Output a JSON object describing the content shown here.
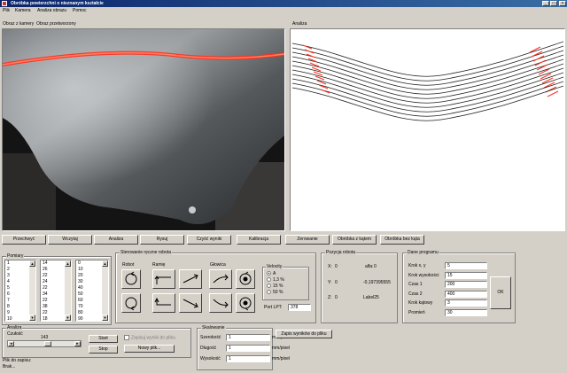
{
  "window": {
    "title": "Obróbka powierzchni o nieznanym kształcie"
  },
  "menu": [
    "Plik",
    "Kamera",
    "Analiza obrazu",
    "Pomoc"
  ],
  "camera": {
    "label_camera": "Obraz z kamery",
    "label_processed": "Obraz przetworzony"
  },
  "analysis": {
    "label": "Analiza"
  },
  "toolbar": [
    "Przechwyć",
    "Wczytaj",
    "Analiza",
    "Rysuj",
    "Czyść wyniki",
    "Kalibracja",
    "Zerowanie",
    "Obróbka z kątem",
    "Obróbka bez kąta"
  ],
  "lists": {
    "title": "Pomiary",
    "col1": [
      "1",
      "2",
      "3",
      "4",
      "5",
      "6",
      "7",
      "8",
      "9",
      "10"
    ],
    "col2": [
      "14",
      "26",
      "22",
      "24",
      "22",
      "34",
      "22",
      "38",
      "22",
      "18"
    ],
    "col3": [
      "0",
      "10",
      "20",
      "30",
      "40",
      "50",
      "60",
      "70",
      "80",
      "90",
      "100"
    ]
  },
  "manual": {
    "title": "Sterowanie ręczne robota",
    "robot": "Robot",
    "arm": "Ramię",
    "head": "Głowica",
    "velocity": {
      "title": "Velocity",
      "options": [
        "A",
        "1,3 %",
        "15 %",
        "50 %"
      ],
      "selected": 0
    },
    "port_label": "Port LPT:",
    "port_value": "378"
  },
  "position": {
    "title": "Pozycja robota",
    "x_label": "X:",
    "x": "0",
    "y_label": "Y:",
    "y": "0",
    "z_label": "Z:",
    "z": "0",
    "alfa_label": "alfa:",
    "alfa": "0",
    "val2": "-0,197395555",
    "val3": "Label25"
  },
  "program": {
    "title": "Dane programu",
    "fields": [
      {
        "label": "Krok x, y",
        "value": "5"
      },
      {
        "label": "Krok wysokości",
        "value": "15"
      },
      {
        "label": "Czas 1",
        "value": "200"
      },
      {
        "label": "Czas 2",
        "value": "400"
      },
      {
        "label": "Krok kątowy",
        "value": "3"
      },
      {
        "label": "Promień",
        "value": "30"
      }
    ],
    "ok_label": "OK"
  },
  "analysis_group": {
    "title": "Analiza",
    "sensitivity_label": "Czułość",
    "sensitivity_value": "143",
    "sensitivity_level": 0.56,
    "start_label": "Start",
    "stop_label": "Stop",
    "save_check_label": "Zapisuj wyniki do pliku",
    "new_file_label": "Nowy plik...",
    "file_label": "Plik do zapisu:",
    "file_value": "Brak..."
  },
  "scale": {
    "title": "Skalowanie",
    "rows": [
      {
        "label": "Szerokość",
        "value": "1",
        "unit": "mm/pixel"
      },
      {
        "label": "Długość",
        "value": "1",
        "unit": "mm/pixel"
      },
      {
        "label": "Wysokość",
        "value": "1",
        "unit": "mm/pixel"
      }
    ]
  },
  "save_results_label": "Zapis wyników do pliku",
  "colors": {
    "titlebar": "#0a246a",
    "face": "#d4d0c8",
    "laser": "#ff3020",
    "profile": "#202020"
  }
}
